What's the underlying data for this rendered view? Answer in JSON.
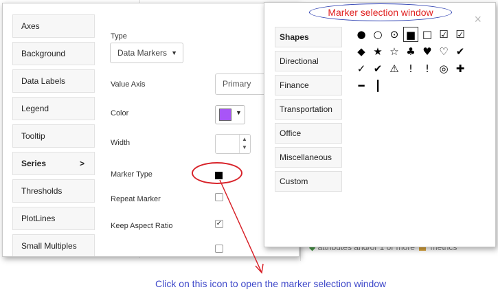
{
  "background": {
    "fragment_text": "attributes and/or 1 or more",
    "fragment_metrics": "metrics"
  },
  "sidebar": {
    "items": [
      {
        "label": "Axes"
      },
      {
        "label": "Background"
      },
      {
        "label": "Data Labels"
      },
      {
        "label": "Legend"
      },
      {
        "label": "Tooltip"
      },
      {
        "label": "Series",
        "chevron": ">"
      },
      {
        "label": "Thresholds"
      },
      {
        "label": "PlotLines"
      },
      {
        "label": "Small Multiples"
      }
    ]
  },
  "properties": {
    "type_label": "Type",
    "type_value": "Data Markers",
    "value_axis_label": "Value Axis",
    "value_axis_value": "Primary",
    "color_label": "Color",
    "color_value": "#a855f7",
    "width_label": "Width",
    "marker_type_label": "Marker Type",
    "repeat_marker_label": "Repeat Marker",
    "keep_aspect_label": "Keep Aspect Ratio"
  },
  "marker_window": {
    "categories": [
      {
        "label": "Shapes",
        "active": true
      },
      {
        "label": "Directional"
      },
      {
        "label": "Finance"
      },
      {
        "label": "Transportation"
      },
      {
        "label": "Office"
      },
      {
        "label": "Miscellaneous"
      },
      {
        "label": "Custom"
      }
    ],
    "close_glyph": "×",
    "markers": [
      {
        "glyph": "●",
        "icon": "filled-circle-icon"
      },
      {
        "glyph": "○",
        "icon": "circle-icon"
      },
      {
        "glyph": "⊙",
        "icon": "dot-circle-icon"
      },
      {
        "glyph": "■",
        "icon": "filled-square-icon",
        "selected": true
      },
      {
        "glyph": "□",
        "icon": "square-icon"
      },
      {
        "glyph": "☑",
        "icon": "check-square-filled-icon"
      },
      {
        "glyph": "☑",
        "icon": "check-square-icon"
      },
      {
        "glyph": "◆",
        "icon": "diamond-icon"
      },
      {
        "glyph": "★",
        "icon": "filled-star-icon"
      },
      {
        "glyph": "☆",
        "icon": "star-icon"
      },
      {
        "glyph": "♣",
        "icon": "tree-icon"
      },
      {
        "glyph": "♥",
        "icon": "filled-heart-icon"
      },
      {
        "glyph": "♡",
        "icon": "heart-icon"
      },
      {
        "glyph": "✔",
        "icon": "check-icon"
      },
      {
        "glyph": "✓",
        "icon": "check-circle-icon"
      },
      {
        "glyph": "✔",
        "icon": "check-circle-filled-icon"
      },
      {
        "glyph": "⚠",
        "icon": "warning-icon"
      },
      {
        "glyph": "!",
        "icon": "exclamation-circle-icon"
      },
      {
        "glyph": "!",
        "icon": "exclamation-icon"
      },
      {
        "glyph": "◎",
        "icon": "bullseye-icon"
      },
      {
        "glyph": "✚",
        "icon": "plus-square-icon"
      },
      {
        "glyph": "━",
        "icon": "horizontal-line-icon"
      },
      {
        "glyph": "┃",
        "icon": "vertical-line-icon"
      }
    ]
  },
  "annotations": {
    "title": "Marker selection window",
    "note": "Click on this icon to open the marker selection window",
    "accent_red": "#d8232a",
    "accent_blue": "#3d47c9"
  }
}
